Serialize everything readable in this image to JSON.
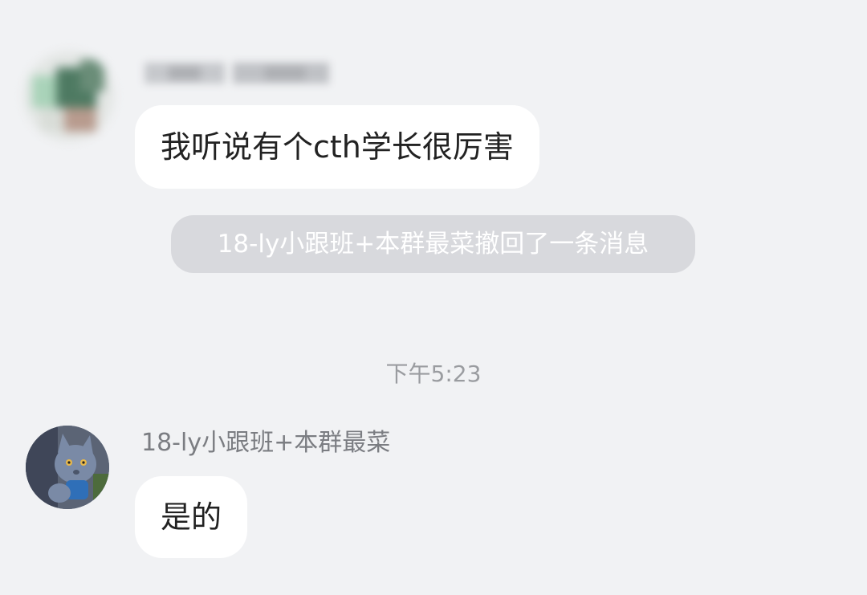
{
  "messages": [
    {
      "sender": "",
      "text": "我听说有个cth学长很厉害"
    },
    {
      "sender": "18-ly小跟班+本群最菜",
      "text": "是的"
    }
  ],
  "recall_notice": "18-ly小跟班+本群最菜撤回了一条消息",
  "timestamp": "下午5:23"
}
